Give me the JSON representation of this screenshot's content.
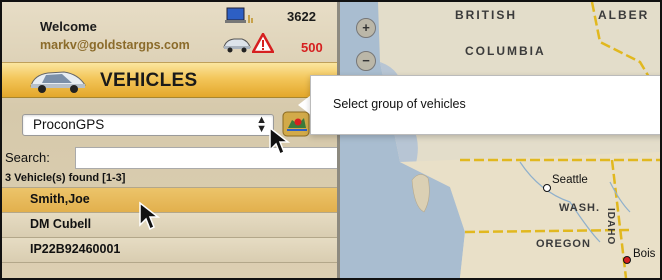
{
  "header": {
    "welcome_label": "Welcome",
    "user_email": "markv@goldstargps.com",
    "count_total": "3622",
    "count_alerts": "500"
  },
  "vehicles_section": {
    "title": "VEHICLES"
  },
  "group_select": {
    "selected": "ProconGPS"
  },
  "search": {
    "label": "Search:",
    "value": ""
  },
  "results": {
    "summary": "3 Vehicle(s) found [1-3]",
    "items": [
      {
        "label": "Smith,Joe",
        "selected": true
      },
      {
        "label": "DM Cubell",
        "selected": false
      },
      {
        "label": "IP22B92460001",
        "selected": false
      }
    ]
  },
  "tooltip": {
    "text": "Select group of vehicles"
  },
  "map": {
    "zoom_in_symbol": "+",
    "zoom_out_symbol": "−",
    "labels": [
      "BRITISH",
      "COLUMBIA",
      "ALBER",
      "WASH.",
      "OREGON",
      "IDAHO"
    ],
    "cities": [
      "Seattle",
      "Bois"
    ]
  },
  "colors": {
    "accent_gold": "#f3c65a",
    "alert_red": "#d62020",
    "email_brown": "#8b6b2a"
  },
  "icons": [
    "laptop-icon",
    "car-small-icon",
    "warning-icon",
    "car-big-icon",
    "map-group-icon",
    "mouse-cursor-icon",
    "zoom-in-icon",
    "zoom-out-icon"
  ]
}
